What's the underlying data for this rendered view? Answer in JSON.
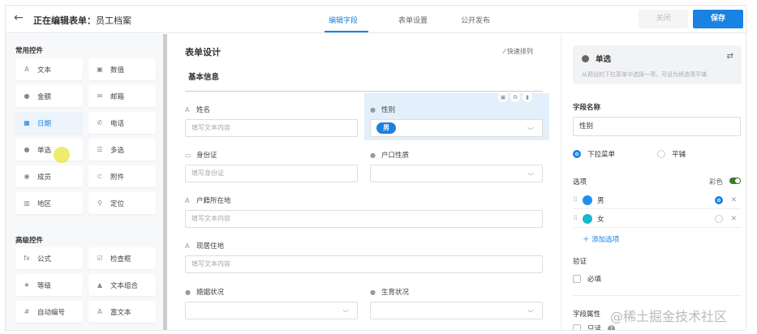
{
  "header": {
    "title_prefix": "正在编辑表单：",
    "title_name": "员工档案",
    "tabs": [
      "编辑字段",
      "表单设置",
      "公开发布"
    ],
    "close_label": "关闭",
    "save_label": "保存"
  },
  "palette": {
    "common_title": "常用控件",
    "common": [
      {
        "label": "文本",
        "icon": "A"
      },
      {
        "label": "数值",
        "icon": "▣"
      },
      {
        "label": "金额",
        "icon": "●"
      },
      {
        "label": "邮箱",
        "icon": "✉"
      },
      {
        "label": "日期",
        "icon": "▦"
      },
      {
        "label": "电话",
        "icon": "✆"
      },
      {
        "label": "单选",
        "icon": "●"
      },
      {
        "label": "多选",
        "icon": "☰"
      },
      {
        "label": "成员",
        "icon": "◉"
      },
      {
        "label": "附件",
        "icon": "⊂"
      },
      {
        "label": "地区",
        "icon": "▥"
      },
      {
        "label": "定位",
        "icon": "⚲"
      }
    ],
    "advanced_title": "高级控件",
    "advanced": [
      {
        "label": "公式",
        "icon": "fx"
      },
      {
        "label": "检查框",
        "icon": "☑"
      },
      {
        "label": "等级",
        "icon": "★"
      },
      {
        "label": "文本组合",
        "icon": "▲"
      },
      {
        "label": "自动编号",
        "icon": "#"
      },
      {
        "label": "富文本",
        "icon": "A"
      }
    ]
  },
  "design": {
    "title": "表单设计",
    "quick_sort": "快速排列",
    "section": "基本信息",
    "fields": {
      "name": {
        "label": "姓名",
        "placeholder": "填写文本内容"
      },
      "gender": {
        "label": "性别",
        "value": "男"
      },
      "id": {
        "label": "身份证",
        "placeholder": "填写身份证"
      },
      "hukou_type": {
        "label": "户口性质"
      },
      "hukou_loc": {
        "label": "户籍所在地",
        "placeholder": "填写文本内容"
      },
      "address": {
        "label": "现居住地",
        "placeholder": "填写文本内容"
      },
      "marriage": {
        "label": "婚姻状况"
      },
      "birth": {
        "label": "生育状况"
      }
    }
  },
  "props": {
    "type": "单选",
    "desc": "从预设的下拉菜单中选择一项，可设为将选项平铺",
    "field_name_label": "字段名称",
    "field_name": "性别",
    "mode_dropdown": "下拉菜单",
    "mode_flat": "平铺",
    "options_label": "选项",
    "color_label": "彩色",
    "options": [
      {
        "label": "男",
        "color": "#1e90ef",
        "default": true
      },
      {
        "label": "女",
        "color": "#17b8c8",
        "default": false
      }
    ],
    "add_option": "添加选项",
    "validate_label": "验证",
    "required": "必填",
    "attr_label": "字段属性",
    "readonly": "只读"
  },
  "watermark": "@稀土掘金技术社区"
}
